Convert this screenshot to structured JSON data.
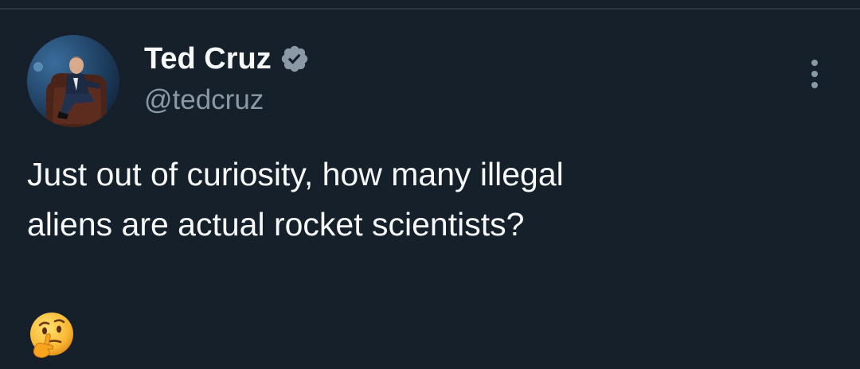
{
  "tweet": {
    "author": {
      "display_name": "Ted Cruz",
      "handle": "@tedcruz",
      "verified": true,
      "avatar_icon": "profile-photo-icon"
    },
    "text_line_1": "Just out of curiosity, how many illegal",
    "text_line_2": "aliens are actual rocket scientists?",
    "emoji": "🤔",
    "emoji_name": "thinking-face-icon"
  },
  "colors": {
    "background": "#15202b",
    "primary_text": "#f7f9f9",
    "secondary_text": "#8b98a5",
    "verified_badge": "#8b98a5"
  },
  "icons": {
    "more": "more-options-icon",
    "verified": "verified-badge-icon"
  }
}
